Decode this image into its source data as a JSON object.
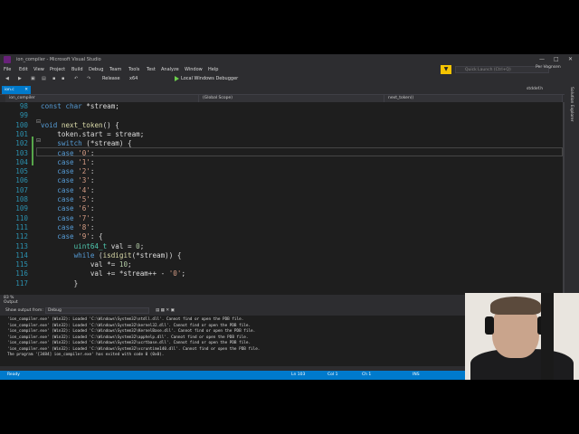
{
  "window": {
    "title": "ion_compiler - Microsoft Visual Studio"
  },
  "menu": [
    "File",
    "Edit",
    "View",
    "Project",
    "Build",
    "Debug",
    "Team",
    "Tools",
    "Test",
    "Analyze",
    "Window",
    "Help"
  ],
  "quick_launch": {
    "placeholder": "Quick Launch (Ctrl+Q)"
  },
  "user": "Per Vognsen",
  "toolbar": {
    "config": "Release",
    "platform": "x64",
    "debugger": "Local Windows Debugger"
  },
  "tabs": {
    "active": "ion.c",
    "right": "stddef.h"
  },
  "navbar": {
    "project": "ion_compiler",
    "scope": "(Global Scope)",
    "member": "next_token()"
  },
  "side_tab": "Solution Explorer",
  "zoom": "83 %",
  "code_lines": [
    {
      "n": "98",
      "html": "<span class=\"kw\">const</span> <span class=\"kw\">char</span> *stream;"
    },
    {
      "n": "99",
      "html": ""
    },
    {
      "n": "100",
      "html": "<span class=\"kw\">void</span> <span class=\"fn\">next_token</span>() {"
    },
    {
      "n": "101",
      "html": "    token.start = stream;"
    },
    {
      "n": "102",
      "html": "    <span class=\"kw\">switch</span> (*stream) {"
    },
    {
      "n": "103",
      "html": "    <span class=\"kw\">case</span> <span class=\"st\">'0'</span>:"
    },
    {
      "n": "104",
      "html": "    <span class=\"kw\">case</span> <span class=\"st\">'1'</span>:"
    },
    {
      "n": "105",
      "html": "    <span class=\"kw\">case</span> <span class=\"st\">'2'</span>:"
    },
    {
      "n": "106",
      "html": "    <span class=\"kw\">case</span> <span class=\"st\">'3'</span>:"
    },
    {
      "n": "107",
      "html": "    <span class=\"kw\">case</span> <span class=\"st\">'4'</span>:"
    },
    {
      "n": "108",
      "html": "    <span class=\"kw\">case</span> <span class=\"st\">'5'</span>:"
    },
    {
      "n": "109",
      "html": "    <span class=\"kw\">case</span> <span class=\"st\">'6'</span>:"
    },
    {
      "n": "110",
      "html": "    <span class=\"kw\">case</span> <span class=\"st\">'7'</span>:"
    },
    {
      "n": "111",
      "html": "    <span class=\"kw\">case</span> <span class=\"st\">'8'</span>:"
    },
    {
      "n": "112",
      "html": "    <span class=\"kw\">case</span> <span class=\"st\">'9'</span>: {"
    },
    {
      "n": "113",
      "html": "        <span class=\"ty\">uint64_t</span> val = <span class=\"nm\">0</span>;"
    },
    {
      "n": "114",
      "html": "        <span class=\"kw\">while</span> (<span class=\"fn\">isdigit</span>(*stream)) {"
    },
    {
      "n": "115",
      "html": "            val *= <span class=\"nm\">10</span>;"
    },
    {
      "n": "116",
      "html": "            val += *stream++ - <span class=\"st\">'0'</span>;"
    },
    {
      "n": "117",
      "html": "        }"
    }
  ],
  "output": {
    "title": "Output",
    "show_from_label": "Show output from:",
    "show_from_value": "Debug",
    "lines": [
      "'ion_compiler.exe' (Win32): Loaded 'C:\\Windows\\System32\\ntdll.dll'. Cannot find or open the PDB file.",
      "'ion_compiler.exe' (Win32): Loaded 'C:\\Windows\\System32\\kernel32.dll'. Cannot find or open the PDB file.",
      "'ion_compiler.exe' (Win32): Loaded 'C:\\Windows\\System32\\KernelBase.dll'. Cannot find or open the PDB file.",
      "'ion_compiler.exe' (Win32): Loaded 'C:\\Windows\\System32\\apphelp.dll'. Cannot find or open the PDB file.",
      "'ion_compiler.exe' (Win32): Loaded 'C:\\Windows\\System32\\ucrtbase.dll'. Cannot find or open the PDB file.",
      "'ion_compiler.exe' (Win32): Loaded 'C:\\Windows\\System32\\vcruntime140.dll'. Cannot find or open the PDB file.",
      "The program '[3484] ion_compiler.exe' has exited with code 0 (0x0)."
    ]
  },
  "status": {
    "ready": "Ready",
    "ln": "Ln 103",
    "col": "Col 1",
    "ch": "Ch 1",
    "ins": "INS"
  }
}
